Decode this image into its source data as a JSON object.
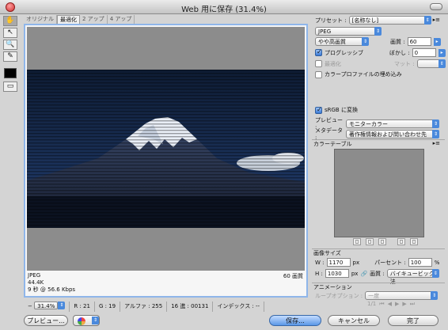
{
  "window": {
    "title": "Web 用に保存 (31.4%)"
  },
  "tabs": [
    "オリジナル",
    "最適化",
    "2 アップ",
    "4 アップ"
  ],
  "tools": [
    "hand-icon",
    "slice-select-icon",
    "zoom-icon",
    "eyedropper-icon"
  ],
  "canvas": {
    "format": "JPEG",
    "file_size": "44.4K",
    "download_time": "9 秒 @ 56.6 Kbps",
    "quality_label": "60 画質"
  },
  "status": {
    "zoom": "31.4%",
    "r": "R : 21",
    "g": "G : 19",
    "alpha": "アルファ : 255",
    "hex": "16 進 : 00131",
    "index": "インデックス : --"
  },
  "buttons": {
    "preview": "プレビュー...",
    "save": "保存...",
    "cancel": "キャンセル",
    "done": "完了"
  },
  "panel": {
    "preset_label": "プリセット :",
    "preset_value": "[名称なし]",
    "format": "JPEG",
    "compression": "やや高画質",
    "quality_label": "画質 :",
    "quality_value": "60",
    "progressive_label": "プログレッシブ",
    "blur_label": "ぼかし :",
    "blur_value": "0",
    "optimize_label": "最適化",
    "matte_label": "マット :",
    "icc_label": "カラープロファイルの埋め込み",
    "srgb_label": "sRGB に変換",
    "preview_label": "プレビュー :",
    "preview_value": "モニターカラー",
    "metadata_label": "メタデータ :",
    "metadata_value": "著作権情報および問い合わせ先",
    "color_table_label": "カラーテーブル",
    "image_size_label": "画像サイズ",
    "w_label": "W :",
    "w_value": "1170",
    "h_label": "H :",
    "h_value": "1030",
    "unit": "px",
    "percent_label": "パーセント :",
    "percent_value": "100",
    "percent_unit": "%",
    "quality2_label": "画質 :",
    "resample": "バイキュービック法",
    "animation_label": "アニメーション",
    "loop_label": "ループオプション :",
    "loop_value": "一度",
    "frame_counter": "1/1"
  }
}
